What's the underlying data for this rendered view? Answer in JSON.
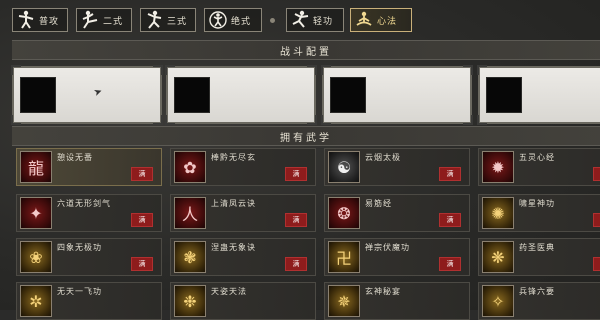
{
  "nav": {
    "tabs": [
      {
        "label": "普攻",
        "icon": "fighter-punch-icon"
      },
      {
        "label": "二式",
        "icon": "fighter-kick-icon"
      },
      {
        "label": "三式",
        "icon": "fighter-stance-icon"
      },
      {
        "label": "绝式",
        "icon": "fighter-ultimate-icon"
      },
      {
        "label": "轻功",
        "icon": "fighter-leap-icon"
      },
      {
        "label": "心法",
        "icon": "meditation-icon",
        "active": true
      }
    ]
  },
  "battle_config": {
    "title": "战斗配置",
    "slots": [
      {},
      {},
      {},
      {}
    ]
  },
  "owned": {
    "title": "拥有武学",
    "skills": [
      {
        "name": "憩设无番",
        "badge": "满",
        "tone": "red",
        "icon": "dragon-icon",
        "highlight": true
      },
      {
        "name": "棒黔无尽玄",
        "badge": "满",
        "tone": "red",
        "icon": "lotus-icon"
      },
      {
        "name": "云烟太极",
        "badge": "满",
        "tone": "bw",
        "icon": "taiji-icon"
      },
      {
        "name": "五灵心经",
        "badge": "满",
        "tone": "red",
        "icon": "flame-icon"
      },
      {
        "name": "六道无形剑气",
        "badge": "满",
        "tone": "red",
        "icon": "sword-energy-icon"
      },
      {
        "name": "上清凤云诀",
        "badge": "满",
        "tone": "red",
        "icon": "figure-icon"
      },
      {
        "name": "易筋经",
        "badge": "满",
        "tone": "red",
        "icon": "tendon-icon"
      },
      {
        "name": "啸星神功",
        "badge": "满",
        "tone": "gold",
        "icon": "star-icon"
      },
      {
        "name": "四象无极功",
        "badge": "满",
        "tone": "gold",
        "icon": "lotus-gold-icon"
      },
      {
        "name": "涅蛊无象诀",
        "badge": "满",
        "tone": "gold",
        "icon": "phoenix-icon"
      },
      {
        "name": "禅宗伏魔功",
        "badge": "满",
        "tone": "gold",
        "icon": "buddha-icon"
      },
      {
        "name": "药圣医典",
        "badge": "满",
        "tone": "gold",
        "icon": "medicine-icon"
      },
      {
        "name": "无天一飞功",
        "badge": "",
        "tone": "gold",
        "icon": "wind-icon"
      },
      {
        "name": "天姿天法",
        "badge": "",
        "tone": "gold",
        "icon": "sky-icon"
      },
      {
        "name": "玄神秘宴",
        "badge": "",
        "tone": "gold",
        "icon": "mystic-icon"
      },
      {
        "name": "兵锋六要",
        "badge": "",
        "tone": "gold",
        "icon": "blade-icon"
      }
    ]
  }
}
